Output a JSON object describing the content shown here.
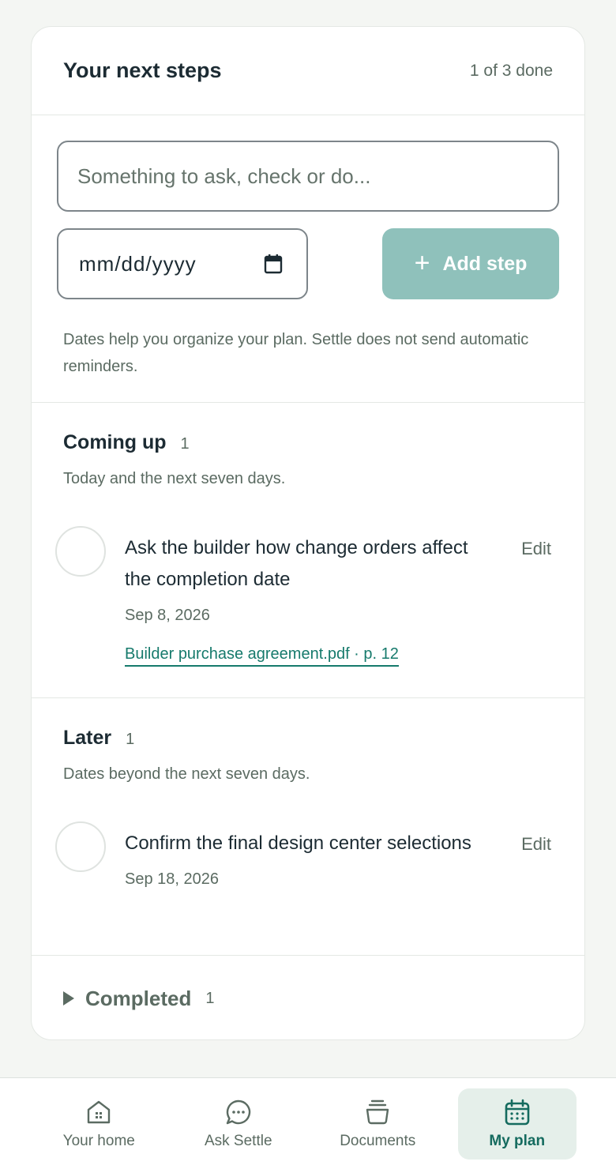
{
  "header": {
    "title": "Your next steps",
    "progress": "1 of 3 done"
  },
  "add_step": {
    "task_placeholder": "Something to ask, check or do...",
    "date_placeholder": "mm/dd/yyyy",
    "add_label": "Add step",
    "hint": "Dates help you organize your plan. Settle does not send automatic reminders."
  },
  "groups": {
    "coming": {
      "title": "Coming up",
      "count": "1",
      "subtitle": "Today and the next seven days.",
      "task": {
        "text": "Ask the builder how change orders affect the completion date",
        "date": "Sep 8, 2026",
        "link": "Builder purchase agreement.pdf · p. 12",
        "edit": "Edit"
      }
    },
    "later": {
      "title": "Later",
      "count": "1",
      "subtitle": "Dates beyond the next seven days.",
      "task": {
        "text": "Confirm the final design center selections",
        "date": "Sep 18, 2026",
        "edit": "Edit"
      }
    }
  },
  "completed": {
    "label": "Completed",
    "count": "1"
  },
  "nav": {
    "items": [
      {
        "label": "Your home",
        "icon": "house-icon"
      },
      {
        "label": "Ask Settle",
        "icon": "chat-icon"
      },
      {
        "label": "Documents",
        "icon": "documents-icon"
      },
      {
        "label": "My plan",
        "icon": "calendar-icon",
        "active": true
      }
    ]
  },
  "colors": {
    "accent": "#156b5f",
    "button": "#8fc1bb",
    "link": "#167a6c",
    "active_nav_bg": "#e5efea"
  }
}
